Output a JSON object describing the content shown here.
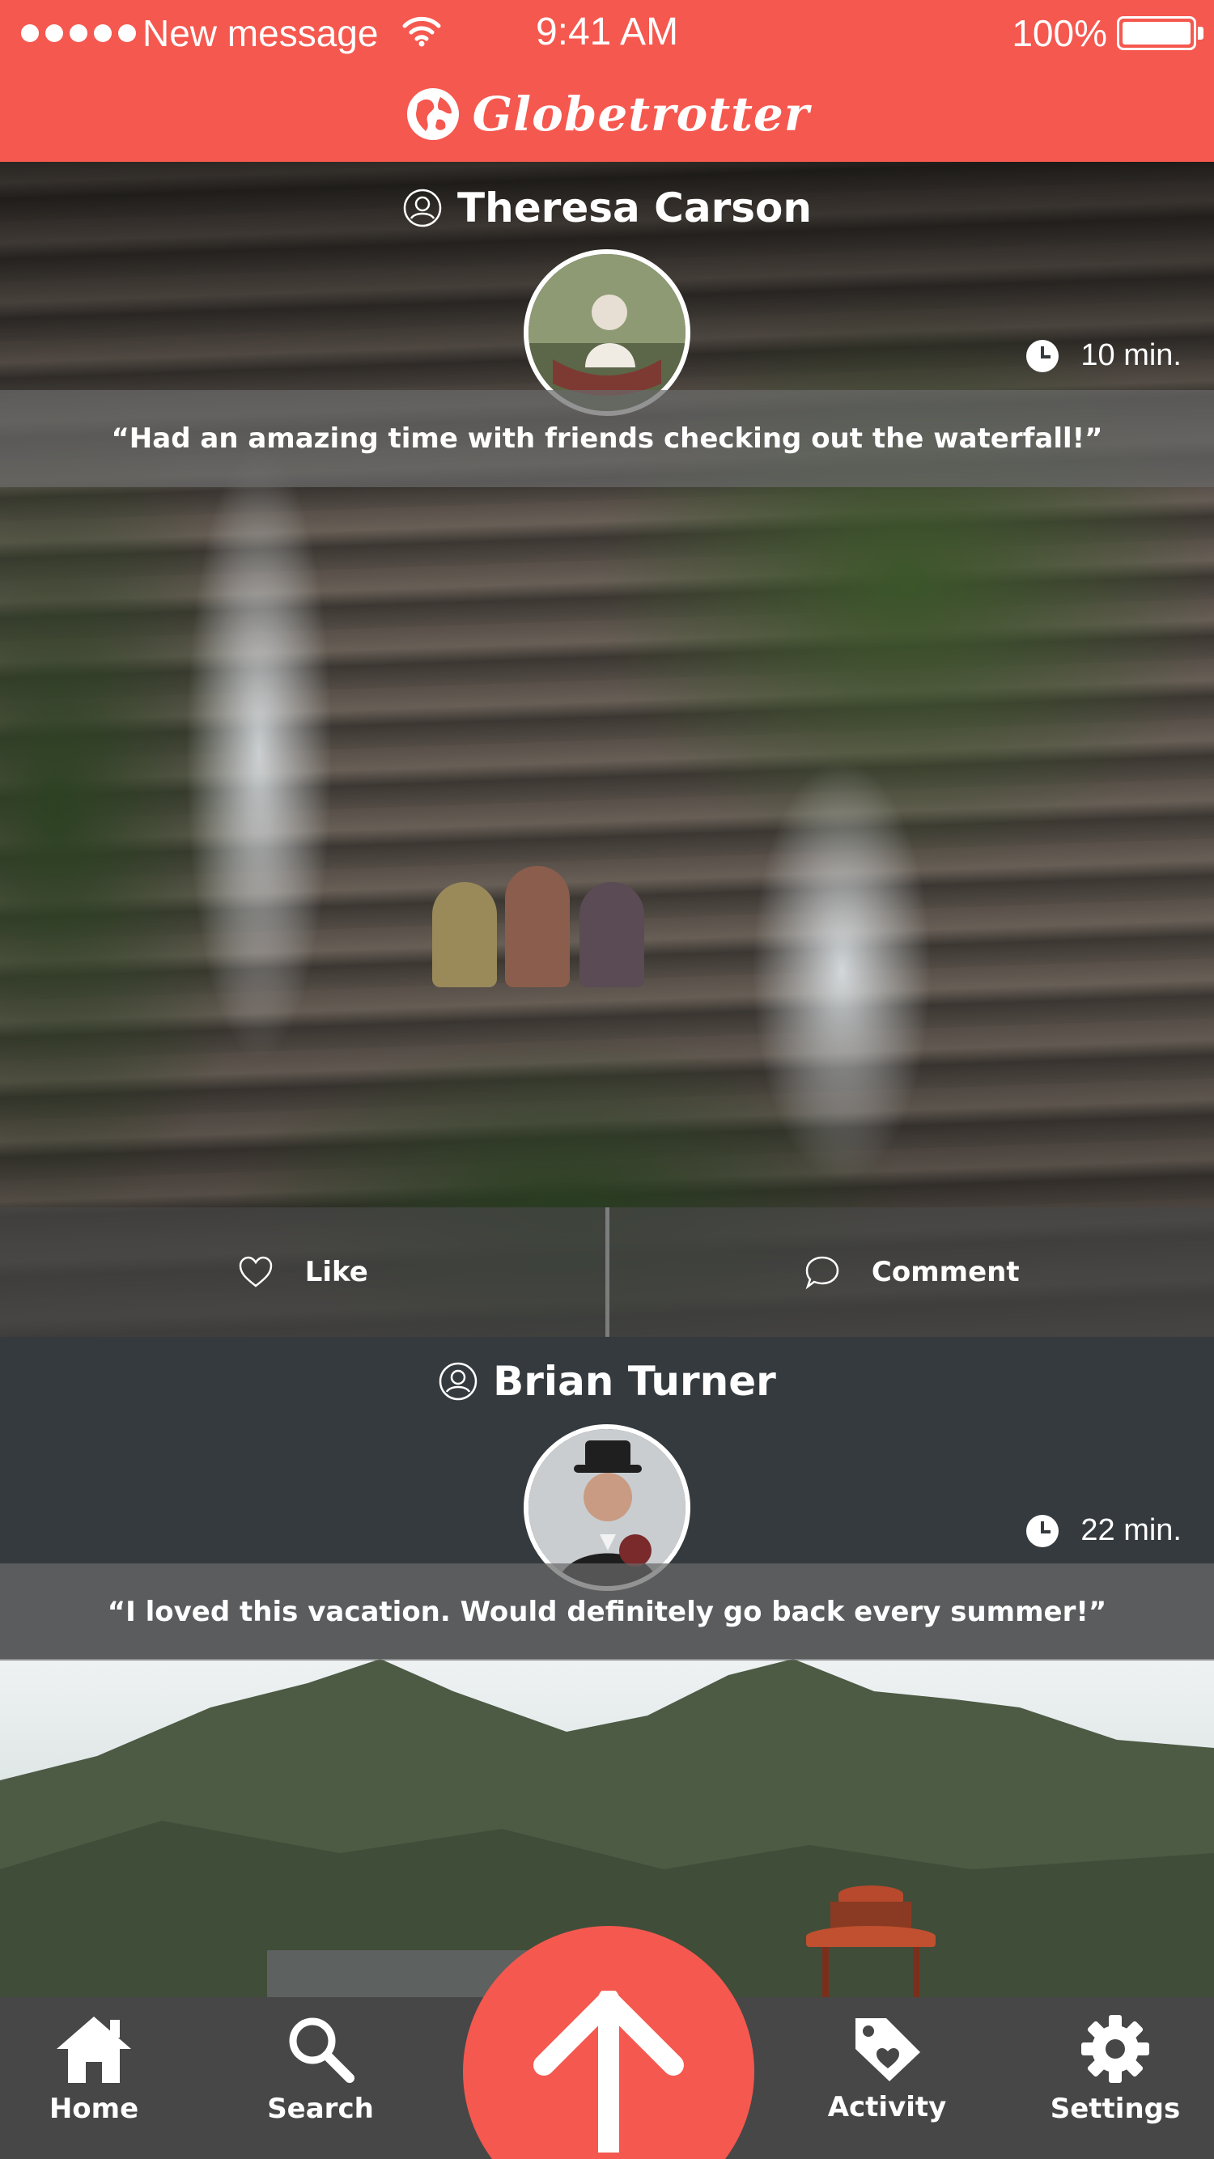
{
  "status_bar": {
    "carrier": "New message",
    "time": "9:41 AM",
    "battery": "100%",
    "icons": [
      "signal-dots-icon",
      "wifi-icon",
      "battery-icon"
    ]
  },
  "app": {
    "name": "Globetrotter",
    "logo_icon": "globe-icon",
    "accent_color": "#f5584f"
  },
  "feed": {
    "posts": [
      {
        "user": "Theresa Carson",
        "time": "10 min.",
        "caption": "“Had an amazing time with friends checking out the waterfall!”",
        "actions": {
          "like": "Like",
          "comment": "Comment"
        }
      },
      {
        "user": "Brian Turner",
        "time": "22 min.",
        "caption": "“I loved this vacation. Would definitely go back every summer!”"
      }
    ]
  },
  "tab_bar": {
    "home": "Home",
    "search": "Search",
    "activity": "Activity",
    "settings": "Settings",
    "icons": [
      "home-icon",
      "search-icon",
      "upload-arrow-icon",
      "tag-heart-icon",
      "gear-icon"
    ]
  }
}
